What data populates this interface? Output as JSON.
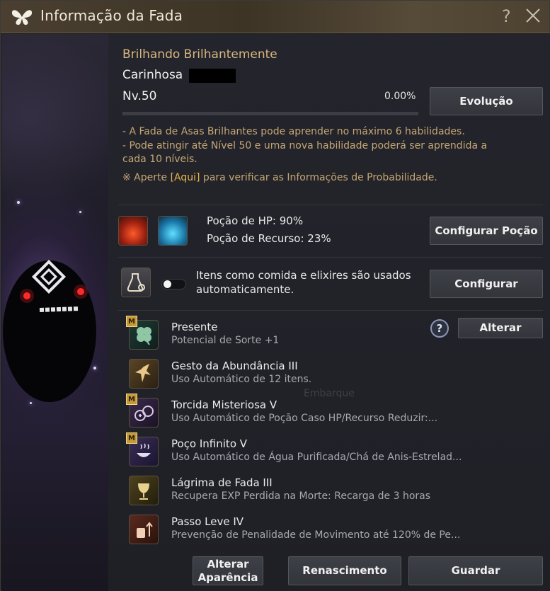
{
  "window": {
    "title": "Informação da Fada",
    "help_glyph": "?",
    "close_icon": "close-icon"
  },
  "fairy": {
    "name": "Brilhando Brilhantemente",
    "personality": "Carinhosa",
    "level": "Nv.50",
    "exp_percent_text": "0.00%",
    "exp_fraction": 0.0,
    "evolve_label": "Evolução"
  },
  "description": {
    "line1": "- A Fada de Asas Brilhantes pode aprender no máximo 6 habilidades.",
    "line2": "- Pode atingir até Nível 50 e uma nova habilidade poderá ser aprendida a",
    "line3": "cada 10 níveis.",
    "probability_prefix": "※ Aperte ",
    "probability_link": "[Aqui]",
    "probability_suffix": " para verificar as Informações de Probabilidade."
  },
  "potions": {
    "hp_label": "Poção de HP: 90%",
    "resource_label": "Poção de Recurso: 23%",
    "configure_label": "Configurar Poção"
  },
  "auto_use": {
    "text": "Itens como comida e elixires são usados automaticamente.",
    "toggle_on": false,
    "configure_label": "Configurar"
  },
  "skills": {
    "change_label": "Alterar",
    "help_glyph": "?",
    "badge": "M",
    "items": [
      {
        "name": "Presente",
        "desc": "Potencial de Sorte +1",
        "icon": "clover-icon"
      },
      {
        "name": "Gesto da Abundância III",
        "desc": "Uso Automático de 12 itens.",
        "icon": "fairy-icon"
      },
      {
        "name": "Torcida Misteriosa V",
        "desc": "Uso Automático de Poção Caso HP/Recurso Reduzir:...",
        "icon": "potions-icon"
      },
      {
        "name": "Poço Infinito V",
        "desc": "Uso Automático de Água Purificada/Chá de Anis-Estrelad...",
        "icon": "bowl-icon"
      },
      {
        "name": "Lágrima de Fada III",
        "desc": "Recupera EXP Perdida na Morte: Recarga de 3 horas",
        "icon": "chalice-icon"
      },
      {
        "name": "Passo Leve IV",
        "desc": "Prevenção de Penalidade de Movimento até 120% de Pe...",
        "icon": "weight-icon"
      }
    ]
  },
  "footer": {
    "appearance_label_1": "Alterar",
    "appearance_label_2": "Aparência",
    "rebirth_label": "Renascimento",
    "store_label": "Guardar"
  },
  "colors": {
    "title_gold": "#d7b680",
    "desc_gold": "#c5a673",
    "link_gold": "#e7b34a"
  }
}
